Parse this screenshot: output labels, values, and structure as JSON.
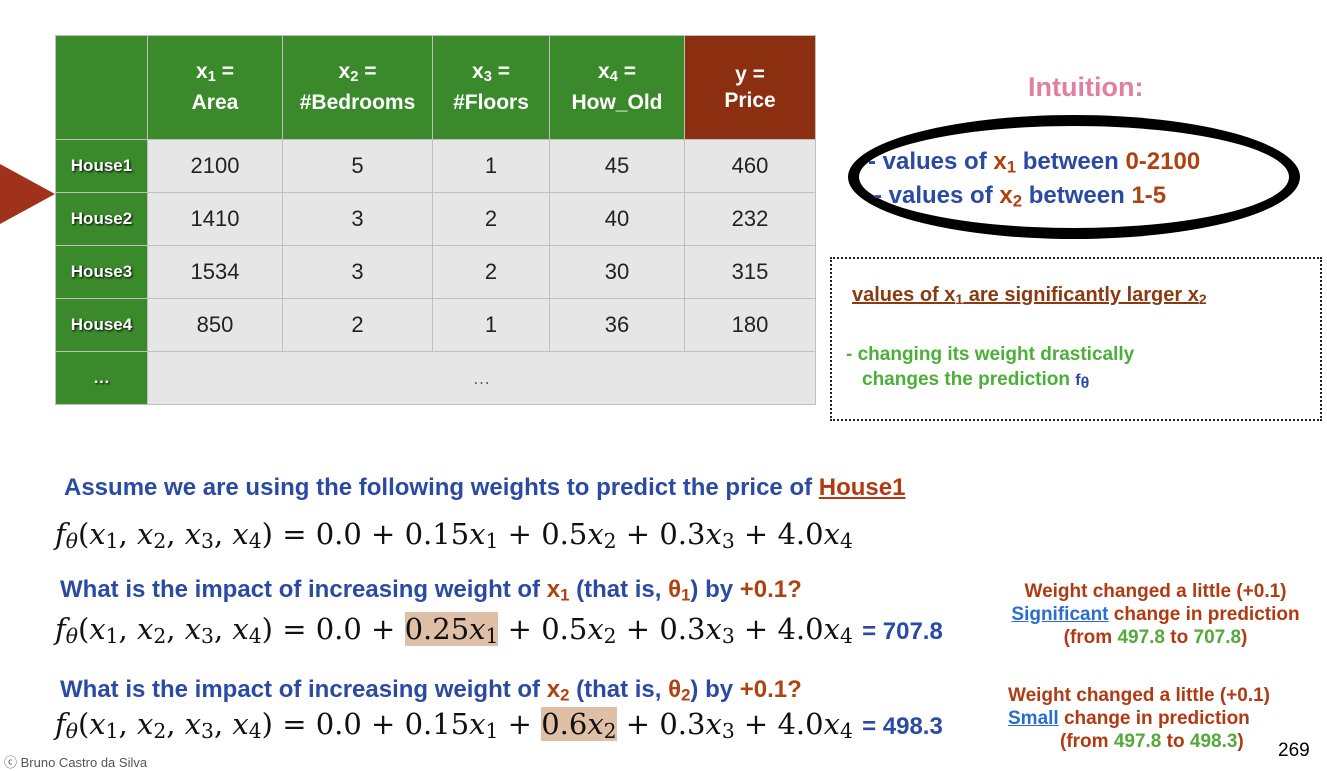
{
  "table": {
    "headers": [
      {
        "var": "x",
        "sub": "1",
        "eq": " =",
        "name": "Area"
      },
      {
        "var": "x",
        "sub": "2",
        "eq": " =",
        "name": "#Bedrooms"
      },
      {
        "var": "x",
        "sub": "3",
        "eq": " =",
        "name": "#Floors"
      },
      {
        "var": "x",
        "sub": "4",
        "eq": " =",
        "name": "How_Old"
      },
      {
        "var": "y",
        "sub": "",
        "eq": " =",
        "name": "Price"
      }
    ],
    "rows": [
      {
        "label": "House1",
        "cells": [
          "2100",
          "5",
          "1",
          "45",
          "460"
        ]
      },
      {
        "label": "House2",
        "cells": [
          "1410",
          "3",
          "2",
          "40",
          "232"
        ]
      },
      {
        "label": "House3",
        "cells": [
          "1534",
          "3",
          "2",
          "30",
          "315"
        ]
      },
      {
        "label": "House4",
        "cells": [
          "850",
          "2",
          "1",
          "36",
          "180"
        ]
      }
    ],
    "last_row_label": "…",
    "last_row_value": "…"
  },
  "intuition": {
    "title": "Intuition:",
    "line1": {
      "pre": "- values of ",
      "var": "x",
      "sub": "1",
      "mid": " between ",
      "range": "0-2100"
    },
    "line2": {
      "pre": "- values of ",
      "var": "x",
      "sub": "2",
      "mid": " between ",
      "range": "1-5"
    }
  },
  "box": {
    "title_pre": "values of x",
    "title_sub1": "1",
    "title_mid": " are significantly larger x",
    "title_sub2": "2",
    "line1": "- changing its weight drastically",
    "line2": "changes the prediction ",
    "f": "f",
    "f_sub": "θ"
  },
  "assume": {
    "text": "Assume we are using the following weights to predict the price of ",
    "link": "House1"
  },
  "formulas": {
    "base": {
      "lhs": "f",
      "coef0": "0.0",
      "c1": "0.15",
      "c2": "0.5",
      "c3": "0.3",
      "c4": "4.0"
    },
    "q1": {
      "pre": "What is the impact of increasing weight of ",
      "x": "x",
      "xs": "1",
      "mid": " (that is, ",
      "t": "θ",
      "ts": "1",
      "post": ") by ",
      "delta": "+0.1?"
    },
    "f1": {
      "c1": "0.25",
      "c2": "0.5",
      "result": "= 707.8"
    },
    "q2": {
      "pre": "What is the impact of increasing weight of ",
      "x": "x",
      "xs": "2",
      "mid": " (that is, ",
      "t": "θ",
      "ts": "2",
      "post": ") by ",
      "delta": "+0.1?"
    },
    "f2": {
      "c1": "0.15",
      "c2": "0.6",
      "result": "= 498.3"
    }
  },
  "side1": {
    "line1": "Weight changed a little (+0.1)",
    "link": "Significant",
    "line2": " change in prediction",
    "from": "(from ",
    "v1": "497.8",
    "to": " to ",
    "v2": "707.8",
    "close": ")"
  },
  "side2": {
    "line1": "Weight changed a little (+0.1)",
    "link": "Small",
    "line2": " change in prediction",
    "from": "(from ",
    "v1": "497.8",
    "to": " to ",
    "v2": "498.3",
    "close": ")"
  },
  "footer": "Bruno Castro da Silva",
  "page_number": "269",
  "colors": {
    "green": "#3a8a2c",
    "brown": "#8b2f10",
    "blue": "#2b4aa3",
    "highlight": "#dfc0a7"
  }
}
